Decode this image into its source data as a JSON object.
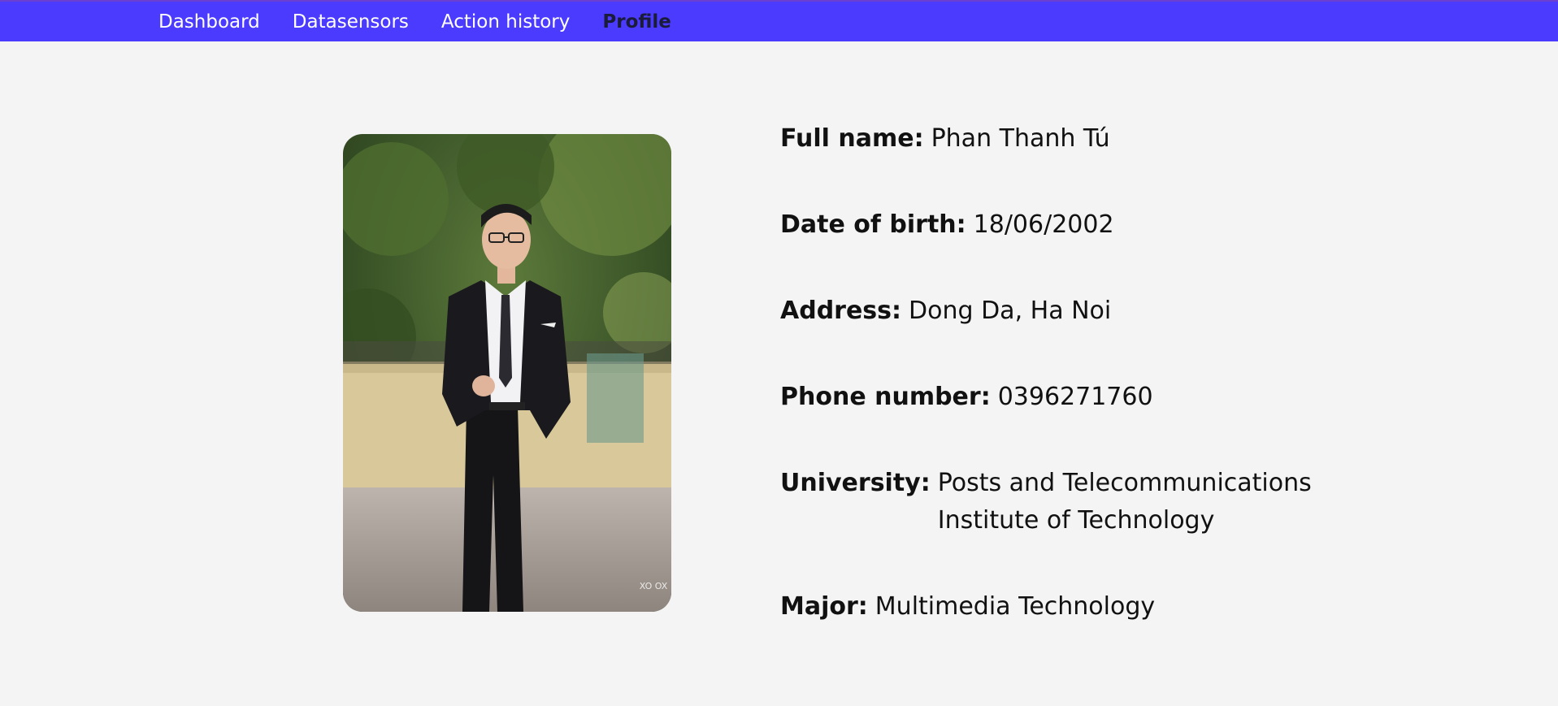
{
  "nav": {
    "items": [
      {
        "label": "Dashboard"
      },
      {
        "label": "Datasensors"
      },
      {
        "label": "Action history"
      },
      {
        "label": "Profile",
        "active": true
      }
    ]
  },
  "photo": {
    "watermark": "XO OX"
  },
  "profile": {
    "full_name_label": "Full name:",
    "full_name": "Phan Thanh Tú",
    "dob_label": "Date of birth:",
    "dob": "18/06/2002",
    "address_label": "Address:",
    "address": "Dong Da, Ha Noi",
    "phone_label": "Phone number:",
    "phone": "0396271760",
    "university_label": "University:",
    "university": "Posts and Telecommunications Institute of Technology",
    "major_label": "Major:",
    "major": "Multimedia Technology"
  },
  "colors": {
    "topbar": "#4a3bff",
    "background": "#f4f4f4",
    "active_nav": "#1b1b3a"
  }
}
